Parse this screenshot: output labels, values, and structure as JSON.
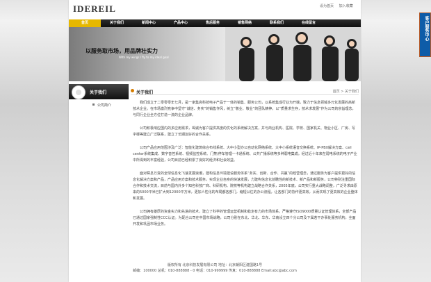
{
  "header": {
    "logo": "IDEREIL",
    "links": [
      "设为首页",
      "加入收藏"
    ]
  },
  "nav": {
    "items": [
      "首页",
      "关于我们",
      "新闻中心",
      "产品中心",
      "售后服务",
      "销售网络",
      "联系我们",
      "在线留言"
    ]
  },
  "banner": {
    "slogan": "以服务取市场，用品牌壮实力",
    "sub": "With my wings I fly to my ideal goal"
  },
  "sidebar": {
    "title": "关于我们",
    "items": [
      "公司简介"
    ]
  },
  "content": {
    "title": "关于我们",
    "breadcrumb": "首页 > 关于我们",
    "paragraphs": [
      "我们成立于二零零零年七月，是一家集高科技电子产品于一体的销售、服务公司，以系统集成行业为开端，致力于信息领域多元化发展的高新技术企业。在市场激烈竞争中坚守“诚信、务实”的销售作风，树立“敬业、敬业”的团队精神，以“质量求生存，技术求发展”作为公司的宗旨理念，与同行企业全方位打造一流的企业品牌。",
      "公司积极响应国内的多应用需求，竭诚为客户提供高度的优化的系统解决方案，并与商业机构、医院、学校、国家机关、物业小区、厂房、写字楼等建立广泛联系，建立了长期友好的合作关系。",
      "公司产品应用范围涉及广泛：智能化建筑综合布线系统、大中小型办公自动化网络系统、大中小系统语音交换系统、IP-PBX解决方案、call center系统集成、数字音控系统、视频监控系统、门禁/停车管理一卡通系统、公共广播系统等多种弱电集成。经过近十年来在弱电系统的电子产业中所得到的丰富经验，公司目前已经积累了良好的经济和社会效益。",
      "面对瞬息万变的全球信息化飞速发展浪潮，建构信息环境建设服务体系“务实、创新、合作、共赢”的经营理念，通过服务为客户提供更好的信息化解决方案和产品，产品应用方案和技术服务，实现企业自身的快速发展，力建构信息化前瞻性的新技术、新产品和新服务，公司特别注重国际合作和技术交流，目前与国内外多个知名科技厂商、科研机构、院校等机构建立战略合作关系，2005年底，公司实行重大战略调整，广泛寻求由原来的5000平米已扩大到12000平方米，更加人性化的布局都各部门，缩短以往的办公流程，让各部门的协作更高效，从而实现了更高效的企业整体和发展。",
      "公司拥有雄厚的资金实力和先进的技术，建立了科学的管理运营机制和稳定有力的市场体系，严格遵守ISO9000质量认证管理体系，全部产品已通过国家强制性CCC认证。为配合公司在中国市场战略，公司分别在东北、华北、华东、华南设立四个分公司及下属若干办事处服务机构，全面开发和巩固市场业务。"
    ]
  },
  "footer": {
    "line1": "版权所有 北京科技发展有限公司  地址：北京朝阳区建国路1号",
    "line2": "邮编：100000  总机：010-888888 - 0  电话：010-999999  传真：010-888888  Email:abc@abc.com"
  },
  "side_tab": {
    "text": "客户服务中心"
  }
}
